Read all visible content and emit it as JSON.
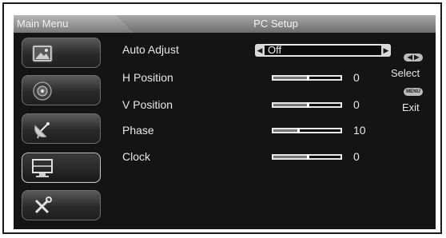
{
  "header": {
    "main_menu": "Main Menu",
    "title": "PC Setup"
  },
  "sidebar": {
    "items": [
      {
        "name": "picture",
        "icon": "picture-icon"
      },
      {
        "name": "audio",
        "icon": "speaker-icon"
      },
      {
        "name": "tv",
        "icon": "satellite-icon"
      },
      {
        "name": "pc-setup",
        "icon": "monitor-icon",
        "active": true
      },
      {
        "name": "settings",
        "icon": "tools-icon"
      }
    ]
  },
  "settings": {
    "auto_adjust": {
      "label": "Auto Adjust",
      "value": "Off"
    },
    "h_position": {
      "label": "H Position",
      "value": "0"
    },
    "v_position": {
      "label": "V Position",
      "value": "0"
    },
    "phase": {
      "label": "Phase",
      "value": "10"
    },
    "clock": {
      "label": "Clock",
      "value": "0"
    }
  },
  "help": {
    "select_key": "",
    "select_label": "Select",
    "menu_key": "MENU",
    "exit_label": "Exit"
  },
  "colors": {
    "osd_background": "#141414",
    "text": "#e8e8e8",
    "title_bar": "#8d8d8d"
  }
}
